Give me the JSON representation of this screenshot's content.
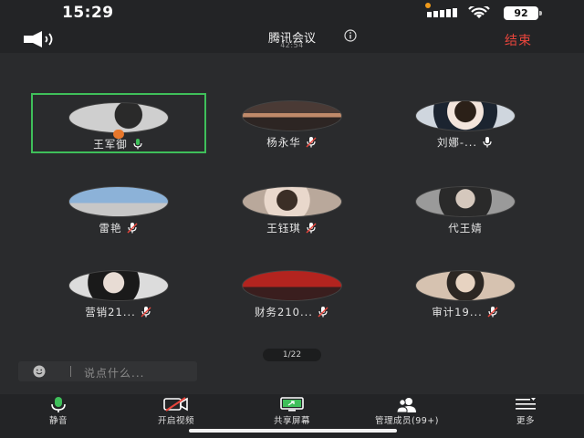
{
  "status_bar": {
    "time": "15:29",
    "battery": "92"
  },
  "header": {
    "title": "腾讯会议",
    "timer": "42:54",
    "end_label": "结束"
  },
  "participants": [
    {
      "name": "王军御",
      "mic": "on"
    },
    {
      "name": "杨永华",
      "mic": "muted"
    },
    {
      "name": "刘娜-...",
      "mic": "off"
    },
    {
      "name": "雷艳",
      "mic": "muted"
    },
    {
      "name": "王钰琪",
      "mic": "muted"
    },
    {
      "name": "代王婧",
      "mic": "none"
    },
    {
      "name": "营销21...",
      "mic": "muted"
    },
    {
      "name": "财务210...",
      "mic": "muted"
    },
    {
      "name": "审计19...",
      "mic": "muted"
    }
  ],
  "pager": "1/22",
  "chat": {
    "placeholder": "说点什么..."
  },
  "toolbar": {
    "mute": "静音",
    "video": "开启视频",
    "share": "共享屏幕",
    "members": "管理成员(99+)",
    "more": "更多"
  },
  "colors": {
    "accent_green": "#3fbf5a",
    "end_red": "#e8453c",
    "host_orange": "#e8772b"
  }
}
